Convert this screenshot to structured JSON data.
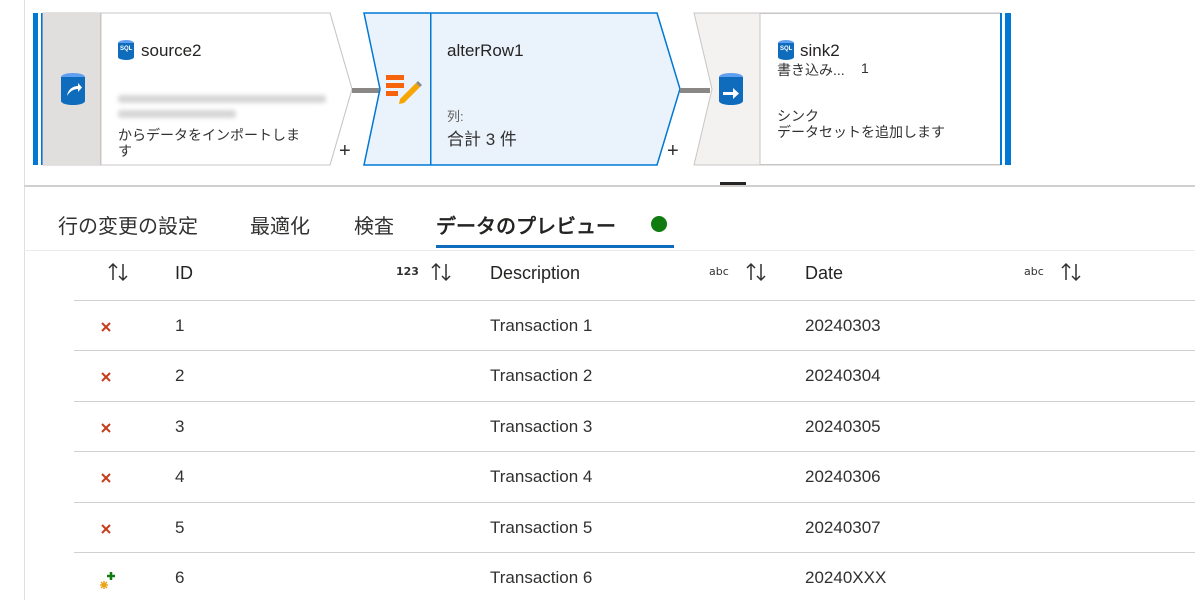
{
  "flow": {
    "source": {
      "title": "source2",
      "subtitle": "からデータをインポートしま\nす",
      "badge": "SQL"
    },
    "alter": {
      "title": "alterRow1",
      "columns_label": "列:",
      "columns_total": "合計 3 件"
    },
    "sink": {
      "title": "sink2",
      "write_label": "書き込み...",
      "write_count": "1",
      "subtitle": "シンク\nデータセットを追加します",
      "badge": "SQL"
    },
    "plus_label": "+"
  },
  "tabs": [
    {
      "label": "行の変更の設定",
      "active": false
    },
    {
      "label": "最適化",
      "active": false
    },
    {
      "label": "検査",
      "active": false
    },
    {
      "label": "データのプレビュー",
      "active": true
    }
  ],
  "status": {
    "color": "#107c10"
  },
  "grid": {
    "columns": [
      {
        "label": "ID",
        "type_tag": "123"
      },
      {
        "label": "Description",
        "type_tag": "abc"
      },
      {
        "label": "Date",
        "type_tag": "abc"
      }
    ],
    "rows": [
      {
        "action": "delete-x-icon",
        "id": "1",
        "description": "Transaction 1",
        "date": "20240303"
      },
      {
        "action": "delete-x-icon",
        "id": "2",
        "description": "Transaction 2",
        "date": "20240304"
      },
      {
        "action": "delete-x-icon",
        "id": "3",
        "description": "Transaction 3",
        "date": "20240305"
      },
      {
        "action": "delete-x-icon",
        "id": "4",
        "description": "Transaction 4",
        "date": "20240306"
      },
      {
        "action": "delete-x-icon",
        "id": "5",
        "description": "Transaction 5",
        "date": "20240307"
      },
      {
        "action": "upsert-icon",
        "id": "6",
        "description": "Transaction 6",
        "date": "20240XXX"
      }
    ]
  },
  "colors": {
    "accent": "#0f6cbd",
    "node_edge": "#0078d4",
    "selected_fill": "#eaf3fc",
    "delete": "#c43e1c",
    "upsert_plus": "#107c10",
    "upsert_star": "#e8a317"
  }
}
